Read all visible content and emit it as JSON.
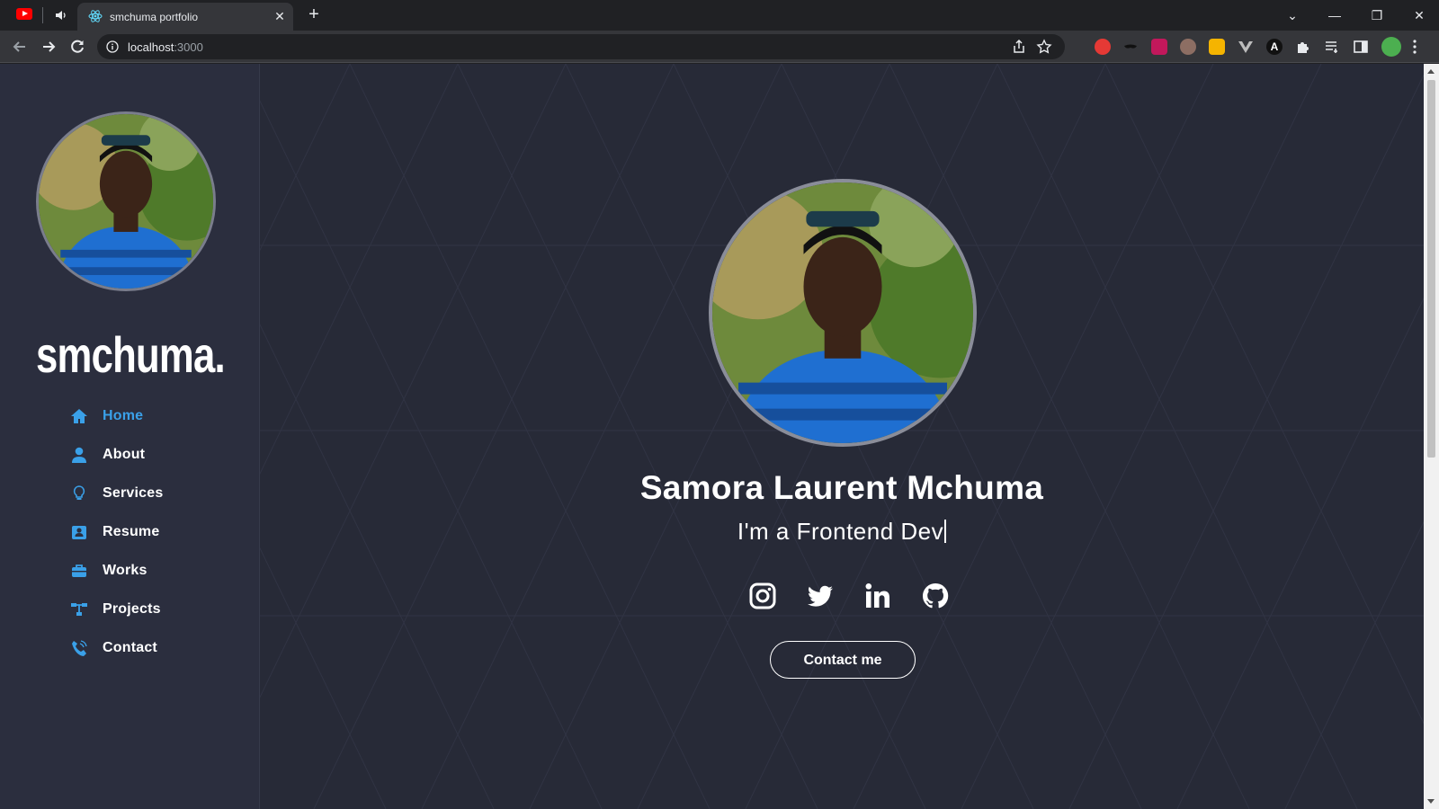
{
  "browser": {
    "tab_title": "smchuma portfolio",
    "tab_close": "✕",
    "new_tab": "+",
    "url_host": "localhost",
    "url_port": ":3000",
    "window_controls": [
      "⌄",
      "—",
      "❐",
      "✕"
    ]
  },
  "sidebar": {
    "brand": "smchuma.",
    "nav": [
      {
        "label": "Home",
        "icon": "home-icon",
        "active": true
      },
      {
        "label": "About",
        "icon": "user-icon",
        "active": false
      },
      {
        "label": "Services",
        "icon": "lightbulb-icon",
        "active": false
      },
      {
        "label": "Resume",
        "icon": "resume-icon",
        "active": false
      },
      {
        "label": "Works",
        "icon": "briefcase-icon",
        "active": false
      },
      {
        "label": "Projects",
        "icon": "sitemap-icon",
        "active": false
      },
      {
        "label": "Contact",
        "icon": "phone-icon",
        "active": false
      }
    ]
  },
  "hero": {
    "name": "Samora Laurent Mchuma",
    "role": "I'm a Frontend Dev",
    "cta": "Contact me",
    "socials": [
      "instagram-icon",
      "twitter-icon",
      "linkedin-icon",
      "github-icon"
    ]
  },
  "colors": {
    "page_bg": "#272a37",
    "sidebar_bg": "#2b2e3e",
    "accent": "#3aa0e8",
    "text": "#ffffff"
  }
}
